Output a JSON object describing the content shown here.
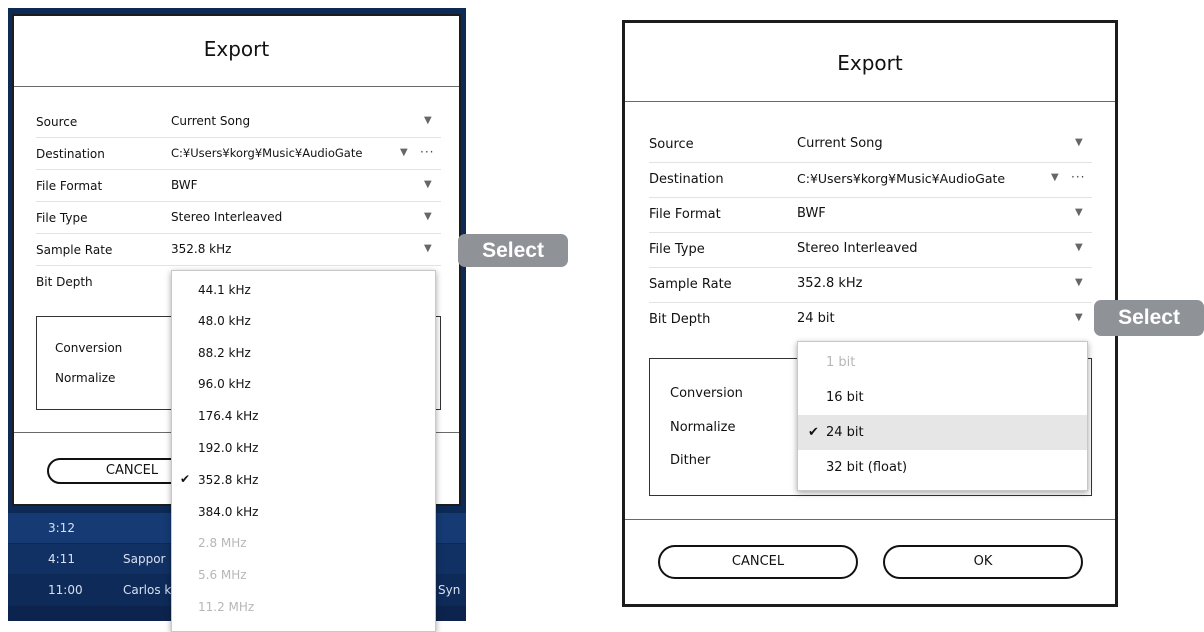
{
  "left": {
    "background_rows": [
      {
        "time": "3:12",
        "title": "",
        "extra": ""
      },
      {
        "time": "4:11",
        "title": "Sappor",
        "extra": ""
      },
      {
        "time": "11:00",
        "title": "Carlos k",
        "extra": "Syn"
      }
    ],
    "dialog": {
      "title": "Export",
      "fields": {
        "source": {
          "label": "Source",
          "value": "Current Song"
        },
        "destination": {
          "label": "Destination",
          "value": "C:¥Users¥korg¥Music¥AudioGate",
          "more": "···"
        },
        "file_format": {
          "label": "File Format",
          "value": "BWF"
        },
        "file_type": {
          "label": "File Type",
          "value": "Stereo Interleaved"
        },
        "sample_rate": {
          "label": "Sample Rate",
          "value": "352.8 kHz"
        },
        "bit_depth": {
          "label": "Bit Depth"
        }
      },
      "options_box": {
        "conversion": "Conversion",
        "normalize": "Normalize"
      },
      "cancel_label": "CANCEL",
      "dropdown": {
        "checkmark": "✔",
        "options": [
          "44.1 kHz",
          "48.0 kHz",
          "88.2 kHz",
          "96.0 kHz",
          "176.4 kHz",
          "192.0 kHz",
          "352.8 kHz",
          "384.0 kHz",
          "2.8 MHz",
          "5.6 MHz",
          "11.2 MHz"
        ],
        "selected": "352.8 kHz",
        "disabled": [
          "2.8 MHz",
          "5.6 MHz",
          "11.2 MHz"
        ]
      }
    },
    "badge": "Select"
  },
  "right": {
    "dialog": {
      "title": "Export",
      "fields": {
        "source": {
          "label": "Source",
          "value": "Current Song"
        },
        "destination": {
          "label": "Destination",
          "value": "C:¥Users¥korg¥Music¥AudioGate",
          "more": "···"
        },
        "file_format": {
          "label": "File Format",
          "value": "BWF"
        },
        "file_type": {
          "label": "File Type",
          "value": "Stereo Interleaved"
        },
        "sample_rate": {
          "label": "Sample Rate",
          "value": "352.8 kHz"
        },
        "bit_depth": {
          "label": "Bit Depth",
          "value": "24 bit"
        }
      },
      "options_box": {
        "conversion": "Conversion",
        "normalize": "Normalize",
        "dither": "Dither"
      },
      "cancel_label": "CANCEL",
      "ok_label": "OK",
      "dropdown": {
        "checkmark": "✔",
        "options": [
          "1 bit",
          "16 bit",
          "24 bit",
          "32 bit (float)"
        ],
        "selected": "24 bit",
        "disabled": [
          "1 bit"
        ]
      }
    },
    "badge": "Select"
  },
  "arrow_glyph": "▼",
  "colors": {
    "badge": "#8f9398",
    "background_app": "#0d2a57",
    "selected_option": "#e6e6e6"
  }
}
